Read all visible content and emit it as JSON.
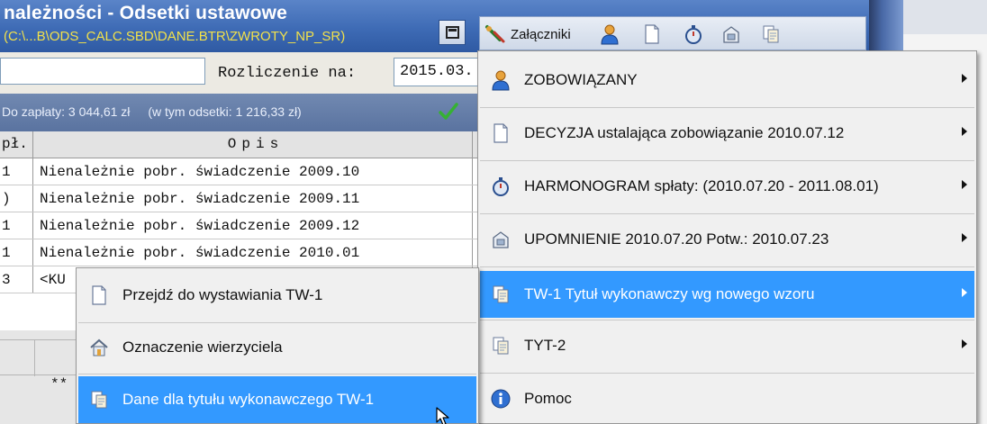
{
  "window": {
    "title": "należności - Odsetki ustawowe",
    "path": "(C:\\...B\\ODS_CALC.SBD\\DANE.BTR\\ZWROTY_NP_SR)"
  },
  "toolbar": {
    "attachments_label": "Załączniki",
    "icons": [
      "calculator-icon",
      "paperclip-icon",
      "person-icon",
      "document-icon",
      "stopwatch-icon",
      "mailbox-icon",
      "copy-documents-icon"
    ]
  },
  "form": {
    "left_value": "",
    "settlement_label": "Rozliczenie na:",
    "settlement_date": "2015.03."
  },
  "summary": {
    "to_pay": "Do zapłaty: 3 044,61 zł",
    "interest": "(w tym odsetki: 1 216,33 zł)"
  },
  "table": {
    "header": {
      "col1": "pł.",
      "col2": "Opis"
    },
    "rows": [
      {
        "c1": "1",
        "c2": "Nienależnie pobr. świadczenie 2009.10"
      },
      {
        "c1": ")",
        "c2": "Nienależnie pobr. świadczenie 2009.11"
      },
      {
        "c1": "1",
        "c2": "Nienależnie pobr. świadczenie 2009.12"
      },
      {
        "c1": "1",
        "c2": "Nienależnie pobr. świadczenie 2010.01"
      },
      {
        "c1": "3",
        "c2": "<KU"
      }
    ],
    "footer_stars": "**"
  },
  "main_menu": {
    "items": [
      {
        "label": "ZOBOWIĄZANY",
        "icon": "person-icon",
        "submenu": true
      },
      {
        "label": "DECYZJA ustalająca zobowiązanie  2010.07.12",
        "icon": "document-icon",
        "submenu": true
      },
      {
        "label": "HARMONOGRAM spłaty: (2010.07.20 - 2011.08.01)",
        "icon": "stopwatch-icon",
        "submenu": true
      },
      {
        "label": "UPOMNIENIE  2010.07.20  Potw.: 2010.07.23",
        "icon": "mailbox-icon",
        "submenu": true
      },
      {
        "label": "TW-1  Tytuł wykonawczy wg nowego wzoru",
        "icon": "copy-documents-icon",
        "submenu": true,
        "highlighted": true
      },
      {
        "label": "TYT-2",
        "icon": "copy-documents-icon",
        "submenu": true
      },
      {
        "label": "Pomoc",
        "icon": "info-icon",
        "submenu": false
      }
    ]
  },
  "sub_menu": {
    "items": [
      {
        "label": "Przejdź do wystawiania  TW-1",
        "icon": "document-icon"
      },
      {
        "label": "Oznaczenie wierzyciela",
        "icon": "house-icon"
      },
      {
        "label": "Dane dla  tytułu wykonawczego TW-1",
        "icon": "copy-documents-icon",
        "highlighted": true
      }
    ]
  },
  "colors": {
    "titlebar": "#3e6bb5",
    "path_text": "#f2e14a",
    "highlight": "#3399ff",
    "summary_bar": "#647da9"
  }
}
